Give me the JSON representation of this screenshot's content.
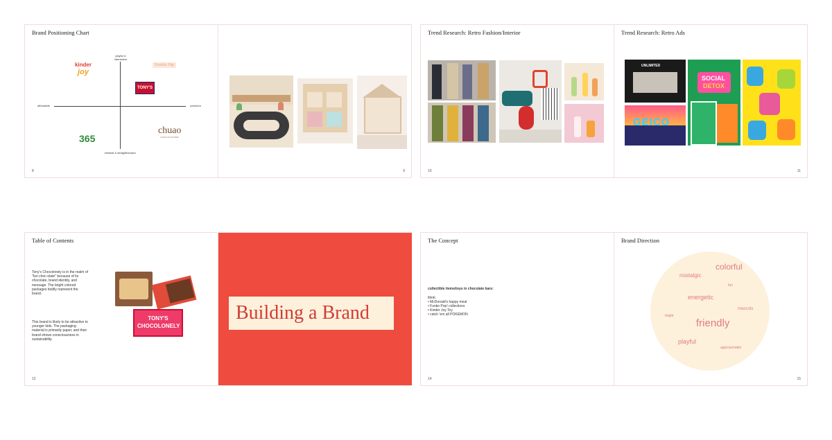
{
  "spreads": {
    "a": {
      "left": {
        "title": "Brand Positioning Chart",
        "page_number": "8",
        "axes": {
          "top": "playful & interactive",
          "bottom": "minimal & straightforward",
          "left": "affordable",
          "right": "premium"
        },
        "brands": {
          "kinder": "kinder",
          "kinder_sub": "joy",
          "double_dip": "Double Dip",
          "tonys": "TONY'S",
          "b365": "365",
          "chuao": "chuao",
          "chuao_sub": "CHOCOLATIER"
        }
      },
      "right": {
        "page_number": "9"
      }
    },
    "b": {
      "left": {
        "title": "Trend Research: Retro Fashion/Interior",
        "page_number": "10"
      },
      "right": {
        "title": "Trend Research: Retro Ads",
        "page_number": "11",
        "ad_texts": {
          "geico": "GEICO",
          "social": "SOCIAL",
          "detox": "DETOX",
          "unlimited": "UNLIMITED"
        }
      }
    },
    "c": {
      "left": {
        "title": "Table of Contents",
        "page_number": "12",
        "paragraph1": "Tony's Chocolonely is in the realm of \"fun choc-olate\" because of its chocolate, brand identity, and message. The bright colored packages boldly represent the brand.",
        "paragraph2": "This brand is likely to be attractive to younger kids. The packaging material is primarily paper, and their brand shows consciousness in sustainability.",
        "pack_text": "TONY'S CHOCOLONELY"
      },
      "right": {
        "headline": "Building a Brand"
      }
    },
    "d": {
      "left": {
        "title": "The Concept",
        "page_number": "14",
        "heading": "collectible items/toys in chocolate bars:",
        "think": "think:",
        "bullets": [
          "• McDonald's happy meal",
          "• Funko Pop! collections",
          "• Kinder Joy Toy",
          "• catch 'em all POKEMON"
        ]
      },
      "right": {
        "title": "Brand Direction",
        "page_number": "15",
        "words": {
          "colorful": "colorful",
          "nostalgic": "nostalgic",
          "fun": "fun",
          "energetic": "energetic",
          "mascots": "mascots",
          "bright": "bright",
          "friendly": "friendly",
          "playful": "playful",
          "approachable": "approachable"
        }
      }
    }
  },
  "colors": {
    "accent_red": "#ef4b3e",
    "cream": "#fdf1dc",
    "serif_red": "#d23b33",
    "cloud_text": "#e07a80",
    "border": "#f2dcdc"
  }
}
